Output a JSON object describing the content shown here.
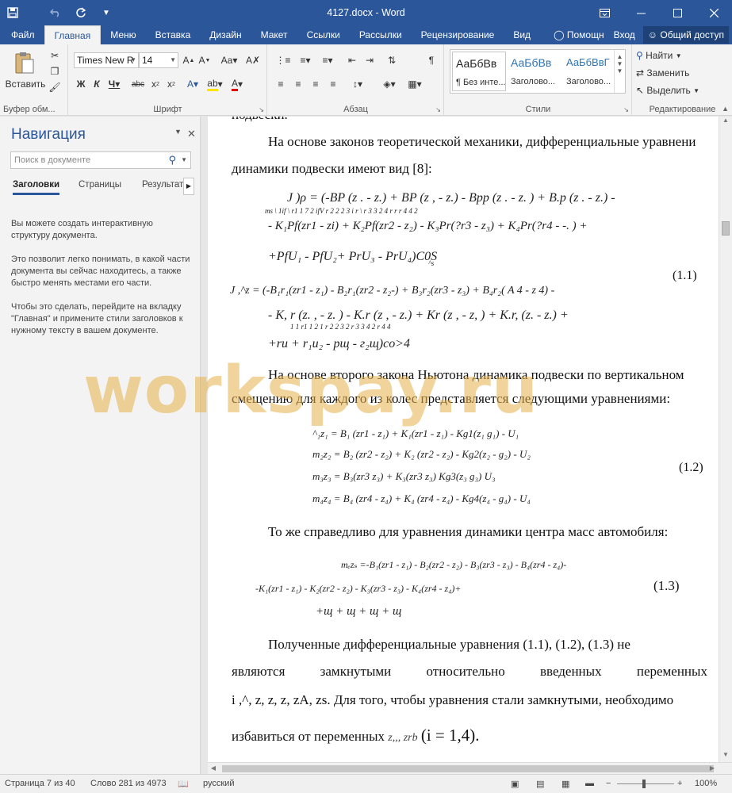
{
  "title_bar": {
    "title": "4127.docx - Word",
    "icons": [
      "save-icon",
      "undo-icon",
      "redo-icon",
      "customize-icon"
    ],
    "window_controls": [
      "ribbon-options-icon",
      "minimize-icon",
      "maximize-icon",
      "close-icon"
    ]
  },
  "ribbon_tabs": [
    "Файл",
    "Главная",
    "Меню",
    "Вставка",
    "Дизайн",
    "Макет",
    "Ссылки",
    "Рассылки",
    "Рецензирование",
    "Вид"
  ],
  "ribbon_right": {
    "help": "Помощн",
    "signin": "Вход",
    "share": "Общий доступ"
  },
  "ribbon": {
    "paste": "Вставить",
    "clipboard": "Буфер обм...",
    "font_name": "Times New R",
    "font_size": "14",
    "font_group": "Шрифт",
    "paragraph_group": "Абзац",
    "styles": [
      {
        "sample": "АаБбВв",
        "name": "¶ Без инте..."
      },
      {
        "sample": "АаБбВв",
        "name": "Заголово..."
      },
      {
        "sample": "АаБбВвГ",
        "name": "Заголово..."
      }
    ],
    "styles_group": "Стили",
    "find": "Найти",
    "replace": "Заменить",
    "select": "Выделить",
    "editing_group": "Редактирование"
  },
  "navigation": {
    "title": "Навигация",
    "search_placeholder": "Поиск в документе",
    "tabs": [
      "Заголовки",
      "Страницы",
      "Результаты"
    ],
    "text": [
      "Вы можете создать интерактивную структуру документа.",
      "Это позволит легко понимать, в какой части документа вы сейчас находитесь, а также быстро менять местами его части.",
      "Чтобы это сделать, перейдите на вкладку \"Главная\" и примените стили заголовков к нужному тексту в вашем документе."
    ]
  },
  "document": {
    "line0": "подвески.",
    "para1_line1": "На основе законов теоретической механики, дифференциальные уравнени",
    "para1_line2": "динамики подвески имеют вид [8]:",
    "eq1": {
      "l1": "J )ρ = (-BP (z . - z.) + BP (z , - z.) - Bpp (z . - z. ) + B.p (z . - z.) -",
      "l1_sub": "ms          \\          1if \\ r1                1 7          2 ifV r 2            2 2            3 i r  \\ r 3          3 2            4 r r r 4        4 2",
      "l2": "-   K₁Pf(zr1 - zi) + K₂Pf(zr2 - z₂) - K₃Pr(?r3 - z₃) + K₄Pr(?r4 - -. ) +",
      "l3": "+PfU₁ - PfU₂+ PrU₃ - PrU₄)C0S",
      "l3_sub": "^s",
      "l4": "J ,^z = (-B₁r₁(zr1 - z₁) - B₂r₁(zr2 - z₂-) + B₃r₂(zr3 - z₃) + B₄r₂( A 4 - z 4) -",
      "l5": "-   K, r (z. , - z. ) - K.r (z , - z.) + Kr (z , - z, )  + K.r, (z. - z.)  +",
      "l5_sub": "1 1  r1      1        2  1      r 2        2      3 2 r 3        3      4 2     r 4        4",
      "l6": "+ru + r₁u₂ - рщ - г₂щ)co>4",
      "num": "(1.1)"
    },
    "para2_line1": "На основе второго закона Ньютона динамика подвески по вертикальном",
    "para2_line2": "смещению для каждого из колес представляется следующими уравнениями:",
    "eq2": {
      "l1": "^₁z₁   = B₁ (zr1 -  z₁) + K₁(zr1 - z₁) - Kg1(z₁        g₁)  -   U₁",
      "l2": "m₂z₂   = B₂ (zr2 -  z₂) +  K₂ (zr2 - z₂) -   Kg2(z₂ -  g₂) -   U₂",
      "l3": "m₃z₃ = B₃(zr3       z₃) + K₃(zr3         z₃) Kg3(z₃          g₃) U₃",
      "l4": "m₄z₄   = B₄ (zr4 -  z₄) +  K₄ (zr4 - z₄) -   Kg4(z₄  -   g₄) -  U₄",
      "num": "(1.2)"
    },
    "para3": "То же справедливо для уравнения динамики центра масс автомобиля:",
    "eq3": {
      "l1": "mₑzₛ =-B₁(zr1 - z₁) - B₂(zr2 - z₂) - B₃(zr3 - z₃) - B₄(zr4 - z₄)-",
      "l2": "-K₁(zr1 - z₁) - K₂(zr2 - z₂) - K₃(zr3 - z₃) - K₄(zr4 - z₄)+",
      "l3": "+щ + щ + щ + щ",
      "num": "(1.3)"
    },
    "para4_line1": "Полученные дифференциальные уравнения (1.1),          (1.2),  (1.3) не",
    "para4_line2_words": [
      "являются",
      "замкнутыми",
      "относительно",
      "введенных",
      "переменных"
    ],
    "para4_line3": "i ,^, z, z, z, zA, zs. Для того, чтобы уравнения стали замкнутыми, необходимо",
    "para4_line4a": "избавиться от переменных ",
    "para4_line4b": "z,,, zrb",
    "para4_line4c": "(i = 1,4).",
    "watermark": "workspay.ru"
  },
  "status_bar": {
    "page": "Страница 7 из 40",
    "words": "Слово 281 из 4973",
    "lang": "русский",
    "zoom": "100%"
  }
}
